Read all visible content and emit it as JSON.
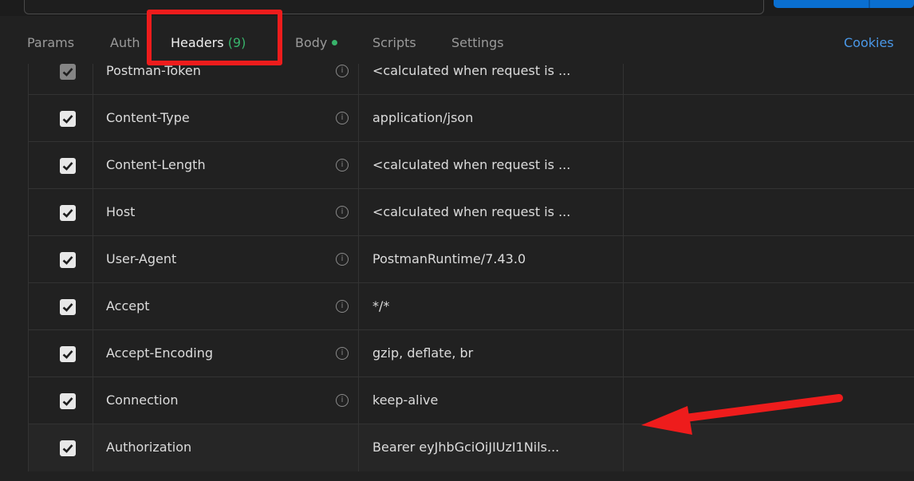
{
  "tabs": [
    {
      "label": "Params",
      "active": false
    },
    {
      "label": "Auth",
      "active": false
    },
    {
      "label": "Headers",
      "count": "(9)",
      "active": true
    },
    {
      "label": "Body",
      "active": false
    },
    {
      "label": "Scripts",
      "active": false
    },
    {
      "label": "Settings",
      "active": false
    }
  ],
  "cookies_label": "Cookies",
  "headers": [
    {
      "key": "Postman-Token",
      "value": "<calculated when request is ...",
      "checked": true,
      "info": true
    },
    {
      "key": "Content-Type",
      "value": "application/json",
      "checked": true,
      "info": true
    },
    {
      "key": "Content-Length",
      "value": "<calculated when request is ...",
      "checked": true,
      "info": true
    },
    {
      "key": "Host",
      "value": "<calculated when request is ...",
      "checked": true,
      "info": true
    },
    {
      "key": "User-Agent",
      "value": "PostmanRuntime/7.43.0",
      "checked": true,
      "info": true
    },
    {
      "key": "Accept",
      "value": "*/*",
      "checked": true,
      "info": true
    },
    {
      "key": "Accept-Encoding",
      "value": "gzip, deflate, br",
      "checked": true,
      "info": true
    },
    {
      "key": "Connection",
      "value": "keep-alive",
      "checked": true,
      "info": true
    },
    {
      "key": "Authorization",
      "value": "Bearer eyJhbGciOiJIUzI1Nils...",
      "checked": true,
      "info": false
    }
  ],
  "colors": {
    "accent": "#38b36b",
    "link": "#4a98e8",
    "highlight": "#ee1c1c"
  }
}
